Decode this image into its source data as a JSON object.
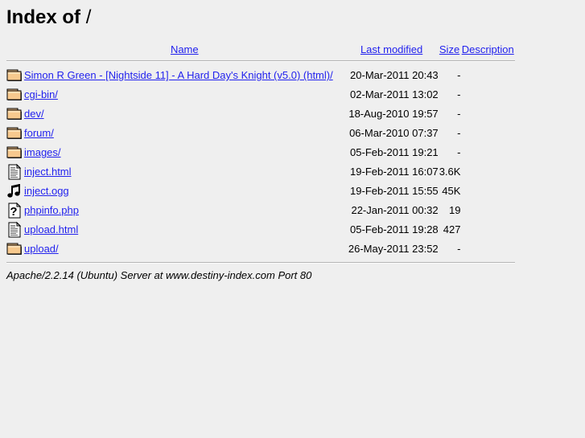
{
  "page": {
    "title_label": "Index of",
    "path": "/"
  },
  "colors": {
    "background": "#efefef",
    "link": "#2222ee",
    "text": "#000000",
    "rule": "#b4b4b4",
    "folder_fill": "#f7c98e",
    "folder_edge": "#000000"
  },
  "table": {
    "headers": {
      "name": "Name",
      "last_modified": "Last modified",
      "size": "Size",
      "description": "Description"
    },
    "rows": [
      {
        "icon": "folder-icon",
        "name": "Simon R Green - [Nightside 11] - A Hard Day's Knight (v5.0) (html)/",
        "last_modified": "20-Mar-2011 20:43",
        "size": "-",
        "description": ""
      },
      {
        "icon": "folder-icon",
        "name": "cgi-bin/",
        "last_modified": "02-Mar-2011 13:02",
        "size": "-",
        "description": ""
      },
      {
        "icon": "folder-icon",
        "name": "dev/",
        "last_modified": "18-Aug-2010 19:57",
        "size": "-",
        "description": ""
      },
      {
        "icon": "folder-icon",
        "name": "forum/",
        "last_modified": "06-Mar-2010 07:37",
        "size": "-",
        "description": ""
      },
      {
        "icon": "folder-icon",
        "name": "images/",
        "last_modified": "05-Feb-2011 19:21",
        "size": "-",
        "description": ""
      },
      {
        "icon": "text-document-icon",
        "name": "inject.html",
        "last_modified": "19-Feb-2011 16:07",
        "size": "3.6K",
        "description": ""
      },
      {
        "icon": "sound-icon",
        "name": "inject.ogg",
        "last_modified": "19-Feb-2011 15:55",
        "size": "45K",
        "description": ""
      },
      {
        "icon": "unknown-file-icon",
        "name": "phpinfo.php",
        "last_modified": "22-Jan-2011 00:32",
        "size": "19",
        "description": ""
      },
      {
        "icon": "text-document-icon",
        "name": "upload.html",
        "last_modified": "05-Feb-2011 19:28",
        "size": "427",
        "description": ""
      },
      {
        "icon": "folder-icon",
        "name": "upload/",
        "last_modified": "26-May-2011 23:52",
        "size": "-",
        "description": ""
      }
    ]
  },
  "footer": {
    "server_signature": "Apache/2.2.14 (Ubuntu) Server at www.destiny-index.com Port 80"
  }
}
